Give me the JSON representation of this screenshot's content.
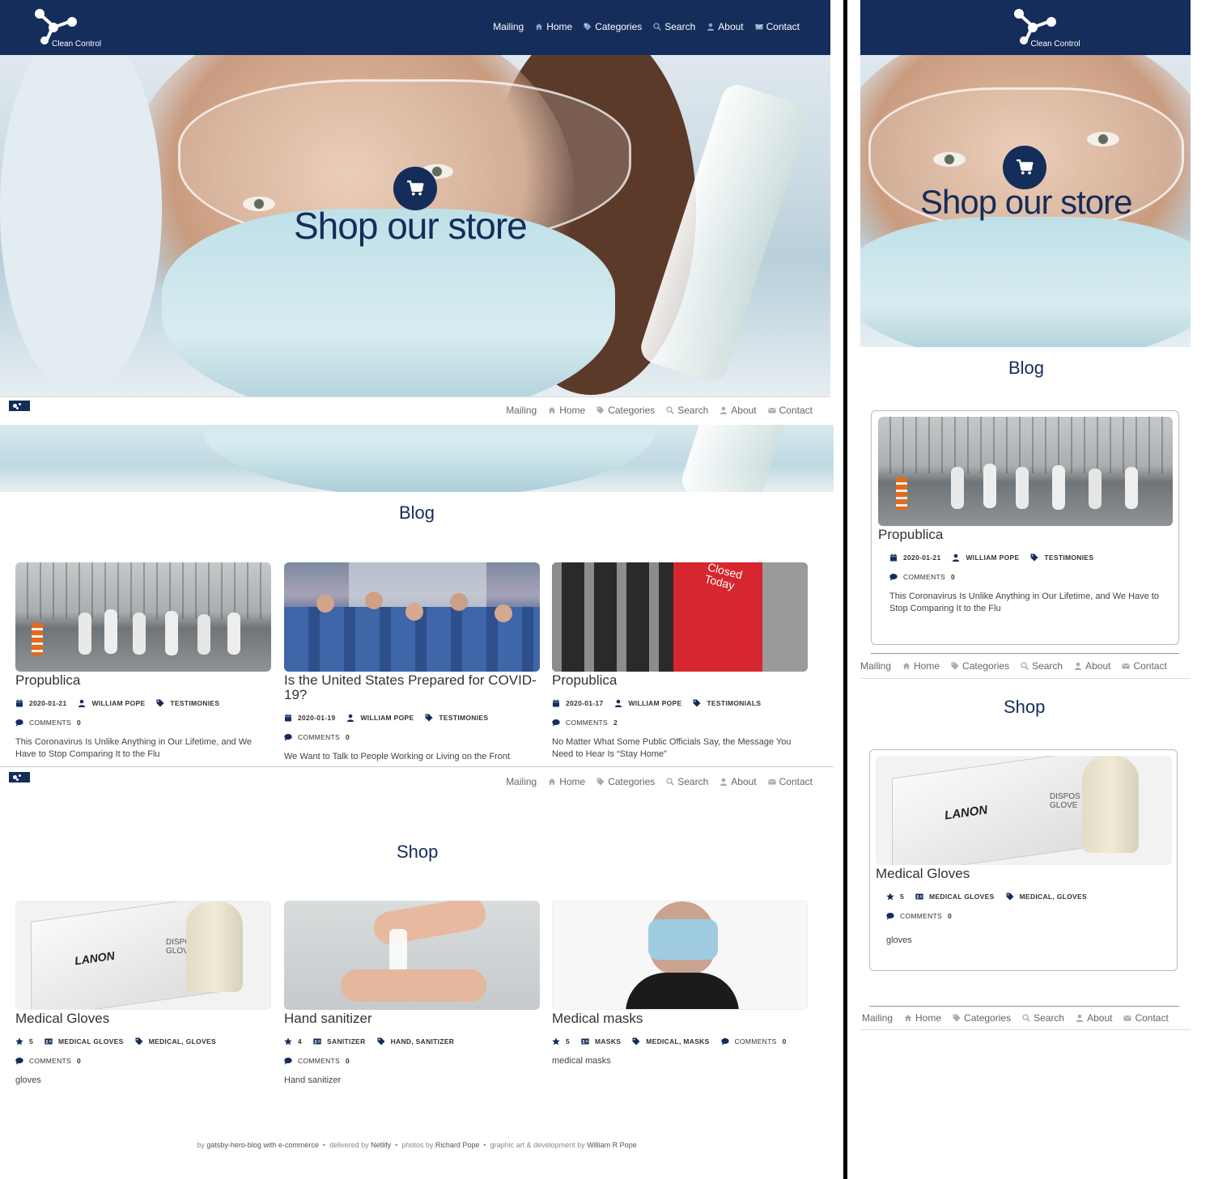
{
  "brand": {
    "name": "Clean Control"
  },
  "nav": {
    "items": [
      {
        "label": "Mailing",
        "icon": "mail-list-icon"
      },
      {
        "label": "Home",
        "icon": "home-icon"
      },
      {
        "label": "Categories",
        "icon": "tag-icon"
      },
      {
        "label": "Search",
        "icon": "search-icon"
      },
      {
        "label": "About",
        "icon": "user-icon"
      },
      {
        "label": "Contact",
        "icon": "envelope-icon"
      }
    ]
  },
  "hero": {
    "title": "Shop our store",
    "icon": "cart-icon"
  },
  "blog": {
    "title": "Blog",
    "posts": [
      {
        "title": "Propublica",
        "date": "2020-01-21",
        "author": "WILLIAM POPE",
        "category": "TESTIMONIES",
        "comments_label": "COMMENTS",
        "comments": "0",
        "excerpt": "This Coronavirus Is Unlike Anything in Our Lifetime, and We Have to Stop Comparing It to the Flu"
      },
      {
        "title": "Is the United States Prepared for COVID-19?",
        "date": "2020-01-19",
        "author": "WILLIAM POPE",
        "category": "TESTIMONIES",
        "comments_label": "COMMENTS",
        "comments": "0",
        "excerpt": "We Want to Talk to People Working or Living on the Front"
      },
      {
        "title": "Propublica",
        "date": "2020-01-17",
        "author": "WILLIAM POPE",
        "category": "TESTIMONIALS",
        "comments_label": "COMMENTS",
        "comments": "2",
        "excerpt": "No Matter What Some Public Officials Say, the Message You Need to Hear Is “Stay Home”"
      }
    ]
  },
  "shop": {
    "title": "Shop",
    "products": [
      {
        "title": "Medical Gloves",
        "rating": "5",
        "category": "MEDICAL GLOVES",
        "tags": "MEDICAL, GLOVES",
        "comments_label": "COMMENTS",
        "comments": "0",
        "excerpt": "gloves"
      },
      {
        "title": "Hand sanitizer",
        "rating": "4",
        "category": "SANITIZER",
        "tags": "HAND, SANITIZER",
        "comments_label": "COMMENTS",
        "comments": "0",
        "excerpt": "Hand sanitizer"
      },
      {
        "title": "Medical masks",
        "rating": "5",
        "category": "MASKS",
        "tags": "MEDICAL, MASKS",
        "comments_label": "COMMENTS",
        "comments": "0",
        "excerpt": "medical masks"
      }
    ]
  },
  "product_images": {
    "gloves_brand": "LANON",
    "gloves_box_text": "DISPOS GLOVE"
  },
  "blog_images": {
    "sign_text": "Closed Today"
  },
  "footer": {
    "by_prefix": "by",
    "by_link": "gatsby-hero-blog with e-commerce",
    "delivered_prefix": "delivered by",
    "delivered_link": "Netlify",
    "photos_prefix": "photos by",
    "photos_link": "Richard Pope",
    "art_prefix": "graphic art & development by",
    "art_link": "William R Pope",
    "sep": "•"
  },
  "colors": {
    "primary": "#142d5b",
    "background": "#ffffff",
    "text": "#333333"
  }
}
